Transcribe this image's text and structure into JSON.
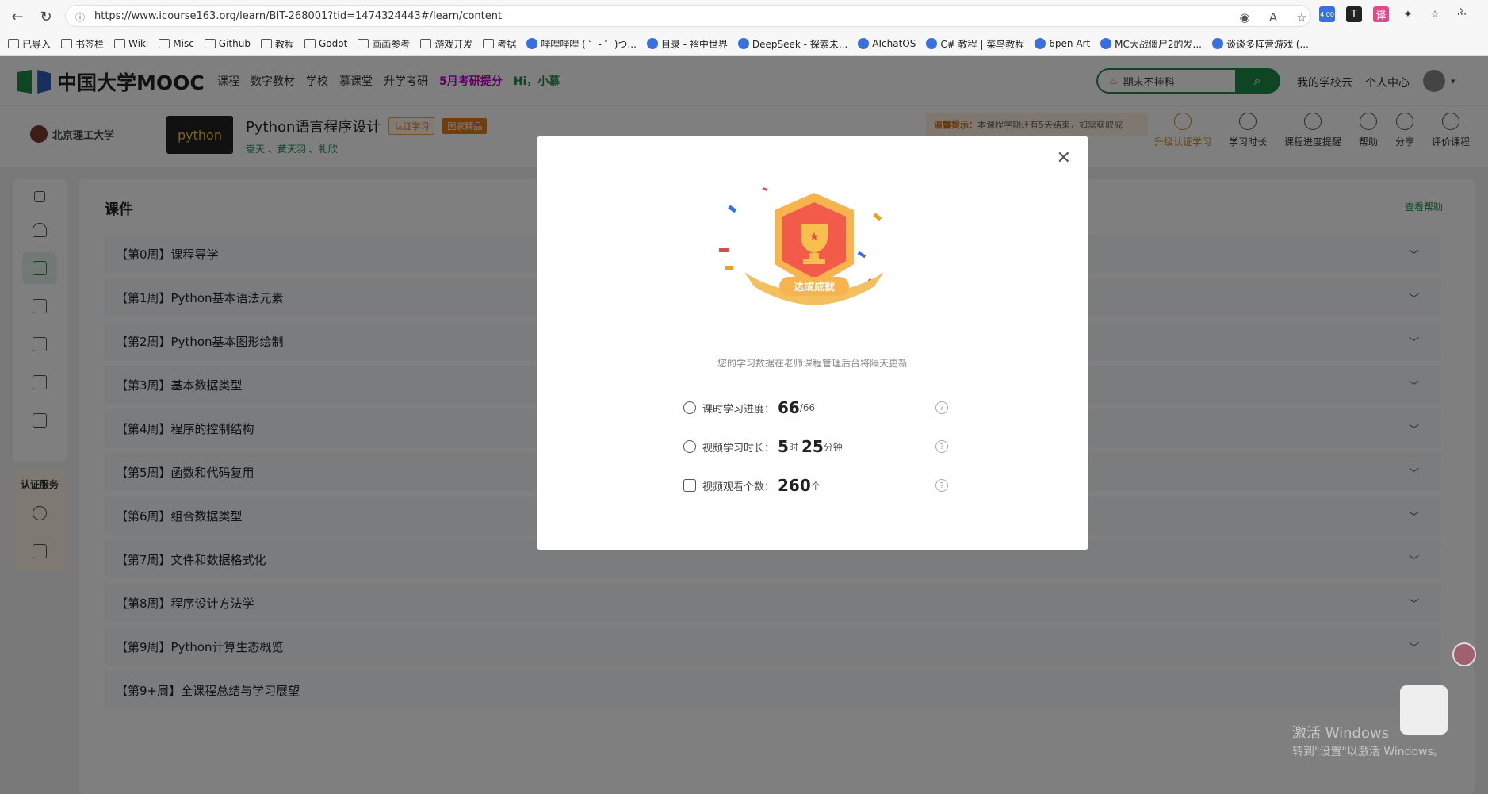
{
  "browser": {
    "url": "https://www.icourse163.org/learn/BIT-268001?tid=1474324443#/learn/content",
    "ext_badge": "4.00",
    "bookmarks": [
      "已导入",
      "书签栏",
      "Wiki",
      "Misc",
      "Github",
      "教程",
      "Godot",
      "画画参考",
      "游戏开发",
      "考据",
      "哔哩哔哩 ( ゜- ゜)つ...",
      "目录 - 褶中世界",
      "DeepSeek - 探索未...",
      "AIchatOS",
      "C# 教程 | 菜鸟教程",
      "6pen Art",
      "MC大战僵尸2的发...",
      "谈谈多阵营游戏 (..."
    ]
  },
  "header": {
    "logo_text": "中国大学MOOC",
    "nav": [
      "课程",
      "数字教材",
      "学校",
      "慕课堂",
      "升学考研"
    ],
    "promo": "5月考研提分",
    "greeting": "Hi，小慕",
    "search_value": "期末不挂科",
    "links": [
      "我的学校云",
      "个人中心"
    ]
  },
  "course": {
    "university": "北京理工大学",
    "thumb_text": "python",
    "title": "Python语言程序设计",
    "tag_cert": "认证学习",
    "tag_national": "国家精品",
    "teachers": "嵩天 、黄天羽 、礼欣",
    "notice_label": "温馨提示：",
    "notice_text": "本课程学期还有5天结束，如需获取成",
    "tools": [
      "升级认证学习",
      "学习时长",
      "课程进度提醒",
      "帮助",
      "分享",
      "评价课程"
    ]
  },
  "sidebar": {
    "section_label": "认证服务"
  },
  "main": {
    "heading": "课件",
    "help": "查看帮助",
    "weeks": [
      "【第0周】课程导学",
      "【第1周】Python基本语法元素",
      "【第2周】Python基本图形绘制",
      "【第3周】基本数据类型",
      "【第4周】程序的控制结构",
      "【第5周】函数和代码复用",
      "【第6周】组合数据类型",
      "【第7周】文件和数据格式化",
      "【第8周】程序设计方法学",
      "【第9周】Python计算生态概览",
      "【第9+周】全课程总结与学习展望"
    ]
  },
  "modal": {
    "badge_label": "达成成就",
    "message": "您的学习数据在老师课程管理后台将隔天更新",
    "progress_label": "课时学习进度：",
    "progress_value": "66",
    "progress_total": "/66",
    "duration_label": "视频学习时长：",
    "duration_hours": "5",
    "duration_hours_unit": "时",
    "duration_minutes": "25",
    "duration_minutes_unit": "分钟",
    "videos_label": "视频观看个数：",
    "videos_value": "260",
    "videos_unit": "个"
  },
  "watermark": {
    "line1": "激活 Windows",
    "line2": "转到\"设置\"以激活 Windows。"
  }
}
